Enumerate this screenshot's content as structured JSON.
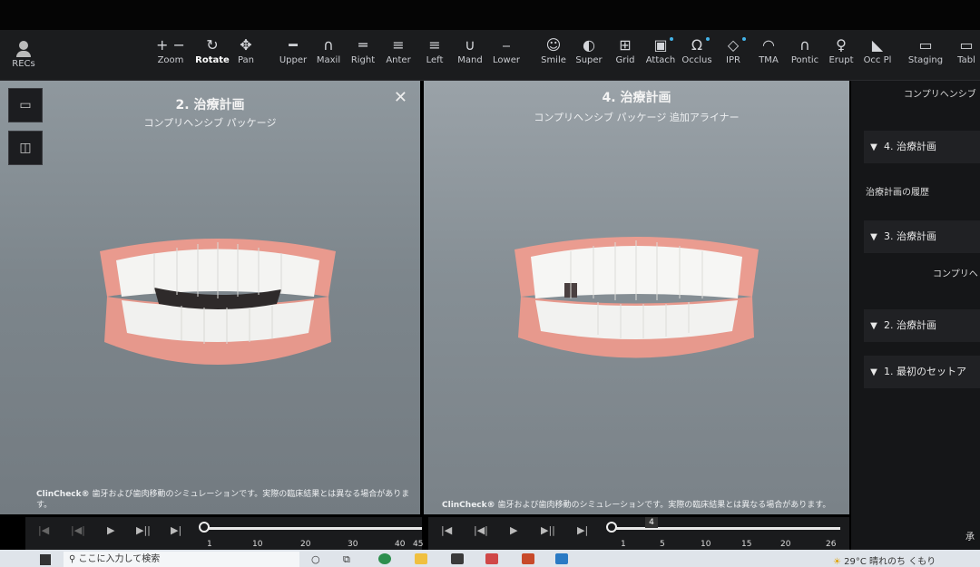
{
  "app": {
    "recs_label": "RECs"
  },
  "toolbar": {
    "items": [
      {
        "label": "Zoom",
        "icon": "zoom-icon"
      },
      {
        "label": "Rotate",
        "icon": "rotate-icon",
        "active": true
      },
      {
        "label": "Pan",
        "icon": "pan-icon"
      },
      {
        "label": "Upper",
        "icon": "upper-jaw-icon"
      },
      {
        "label": "Maxil",
        "icon": "maxillary-icon"
      },
      {
        "label": "Right",
        "icon": "right-view-icon"
      },
      {
        "label": "Anter",
        "icon": "anterior-view-icon"
      },
      {
        "label": "Left",
        "icon": "left-view-icon"
      },
      {
        "label": "Mand",
        "icon": "mandibular-icon"
      },
      {
        "label": "Lower",
        "icon": "lower-jaw-icon"
      },
      {
        "label": "Smile",
        "icon": "smile-icon"
      },
      {
        "label": "Super",
        "icon": "superimpose-icon"
      },
      {
        "label": "Grid",
        "icon": "grid-icon"
      },
      {
        "label": "Attach",
        "icon": "attachment-icon"
      },
      {
        "label": "Occlus",
        "icon": "occlusion-icon"
      },
      {
        "label": "IPR",
        "icon": "ipr-icon"
      },
      {
        "label": "TMA",
        "icon": "tma-icon"
      },
      {
        "label": "Pontic",
        "icon": "pontic-icon"
      },
      {
        "label": "Erupt",
        "icon": "erupt-icon"
      },
      {
        "label": "Occ Pl",
        "icon": "occlusal-plane-icon"
      },
      {
        "label": "Staging",
        "icon": "staging-icon"
      },
      {
        "label": "Tabl",
        "icon": "table-icon"
      }
    ]
  },
  "panel_left": {
    "title": "2. 治療計画",
    "subtitle": "コンプリヘンシブ パッケージ",
    "disclaimer_brand": "ClinCheck®",
    "disclaimer": "歯牙および歯肉移動のシミュレーションです。実際の臨床結果とは異なる場合があります。",
    "ticks": [
      "1",
      "10",
      "20",
      "30",
      "40",
      "45"
    ]
  },
  "panel_right": {
    "title": "4. 治療計画",
    "subtitle": "コンプリヘンシブ パッケージ 追加アライナー",
    "disclaimer_brand": "ClinCheck®",
    "disclaimer": "歯牙および歯肉移動のシミュレーションです。実際の臨床結果とは異なる場合があります。",
    "current_stage": "4",
    "ticks": [
      "1",
      "5",
      "10",
      "15",
      "20",
      "26"
    ]
  },
  "right_pane": {
    "top_text": "コンプリヘンシブ",
    "plan4": "4. 治療計画",
    "history_label": "治療計画の履歴",
    "plan3": "3. 治療計画",
    "plan3_sub": "コンプリヘ",
    "plan2": "2. 治療計画",
    "plan1": "1. 最初のセットア",
    "bottom_text": "承"
  },
  "taskbar": {
    "search_placeholder": "ここに入力して検索",
    "weather": "29°C 晴れのち くもり"
  }
}
